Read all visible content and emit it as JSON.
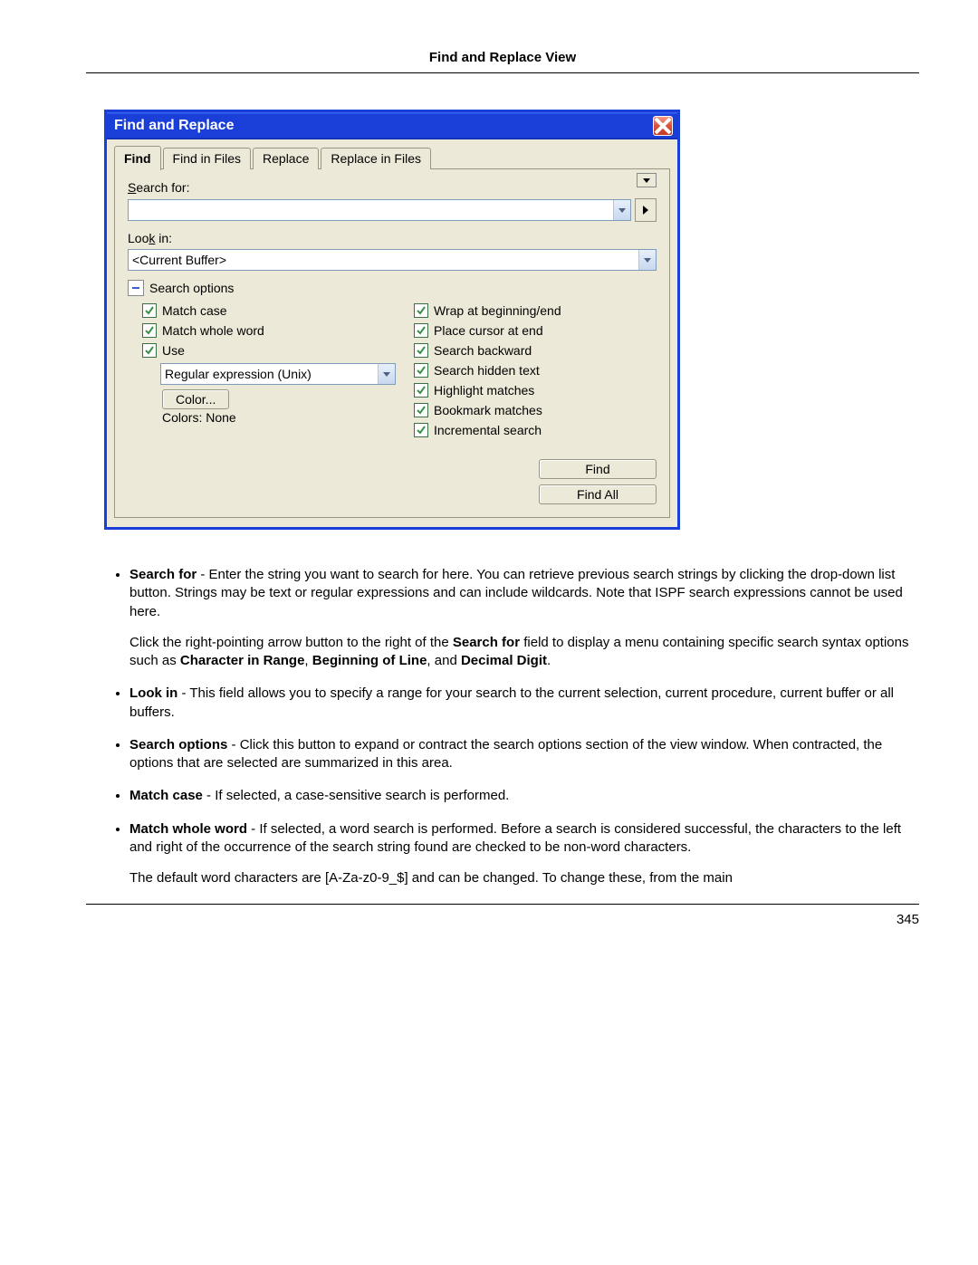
{
  "page": {
    "header_title": "Find and Replace View",
    "number": "345"
  },
  "dialog": {
    "title": "Find and Replace",
    "tabs": [
      "Find",
      "Find in Files",
      "Replace",
      "Replace in Files"
    ],
    "search_for_label_prefix": "S",
    "search_for_label_rest": "earch for:",
    "search_for_value": "",
    "look_in_label_prefix": "Loo",
    "look_in_label_under": "k",
    "look_in_label_rest": " in:",
    "look_in_value": "<Current Buffer>",
    "options_header": "Search options",
    "left_opts": {
      "match_case": "Match case",
      "match_word": "Match whole word",
      "use": "Use",
      "use_combo": "Regular expression (Unix)",
      "color_button": "Color...",
      "colors_label": "Colors: None"
    },
    "right_opts": {
      "wrap": "Wrap at beginning/end",
      "cursor_end": "Place cursor at end",
      "backward": "Search backward",
      "hidden": "Search hidden text",
      "highlight": "Highlight matches",
      "bookmark": "Bookmark matches",
      "incremental": "Incremental search"
    },
    "find_btn": "Find",
    "find_all_btn": "Find All"
  },
  "doc": {
    "b1_bold": "Search for",
    "b1_text": " - Enter the string you want to search for here. You can retrieve previous search strings by clicking the drop-down list button. Strings may be text or regular expressions and can include wildcards. Note that ISPF search expressions cannot be used here.",
    "b1_p_pre": "Click the right-pointing arrow button to the right of the ",
    "b1_p_bold": "Search for",
    "b1_p_mid": " field to display a menu containing specific search syntax options such as ",
    "b1_p_b1": "Character in Range",
    "b1_p_s1": ", ",
    "b1_p_b2": "Beginning of Line",
    "b1_p_s2": ", and ",
    "b1_p_b3": "Decimal Digit",
    "b1_p_end": ".",
    "b2_bold": "Look in",
    "b2_text": " - This field allows you to specify a range for your search to the current selection, current procedure, current buffer or all buffers.",
    "b3_bold": "Search options",
    "b3_text": " - Click this button to expand or contract the search options section of the view window. When contracted, the options that are selected are summarized in this area.",
    "b4_bold": "Match case",
    "b4_text": " - If selected, a case-sensitive search is performed.",
    "b5_bold": "Match whole word",
    "b5_text": " - If selected, a word search is performed. Before a search is considered successful, the characters to the left and right of the occurrence of the search string found are checked to be non-word characters.",
    "b5_p": "The default word characters are [A-Za-z0-9_$] and can be changed. To change these, from the main"
  }
}
